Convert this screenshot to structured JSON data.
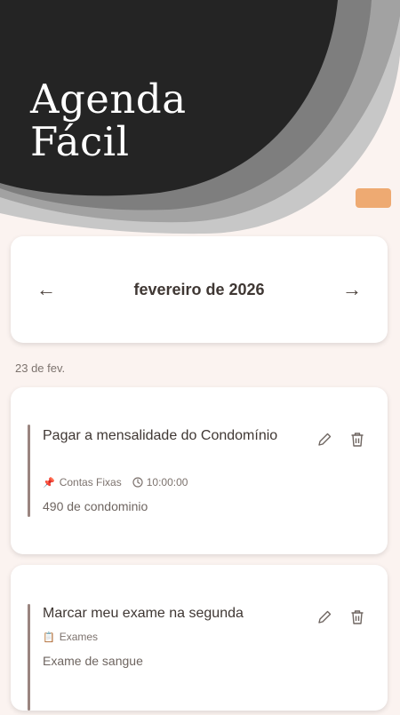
{
  "app": {
    "title_line1": "Agenda",
    "title_line2": "Fácil"
  },
  "calendar": {
    "month": "fevereiro de 2026",
    "prev_arrow": "←",
    "next_arrow": "→"
  },
  "date_group": "23 de fev.",
  "tasks": [
    {
      "title": "Pagar a mensalidade do Condomínio",
      "category_icon": "📌",
      "category": "Contas Fixas",
      "time": "10:00:00",
      "description": "490 de condominio"
    },
    {
      "title": "Marcar meu exame na segunda",
      "category_icon": "📋",
      "category": "Exames",
      "description": "Exame de sangue"
    }
  ],
  "colors": {
    "background": "#fbf3f0",
    "header_dark": "#242424",
    "accent_orange": "#eeaa72",
    "task_bar": "#9a8580"
  },
  "icons": {
    "prev": "arrow-left-icon",
    "next": "arrow-right-icon",
    "edit": "pencil-icon",
    "delete": "trash-icon",
    "time": "clock-icon",
    "category_pin": "pushpin-icon",
    "category_clipboard": "clipboard-icon"
  }
}
